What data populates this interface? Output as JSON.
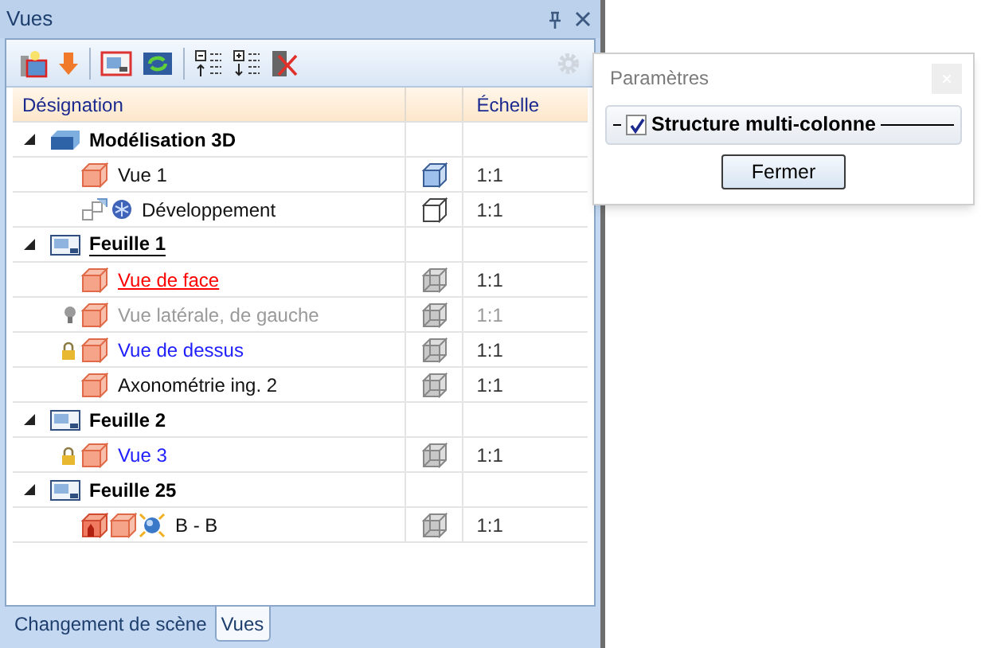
{
  "panel": {
    "title": "Vues"
  },
  "table": {
    "columns": [
      "Désignation",
      "Échelle"
    ],
    "rows": [
      {
        "kind": "model",
        "label": "Modélisation 3D",
        "expanded": true,
        "current": false,
        "children": [
          {
            "kind": "view",
            "label": "Vue 1",
            "scale": "1:1",
            "preview": {
              "kind": "solid"
            },
            "active": false,
            "hidden": false,
            "locked": false
          },
          {
            "kind": "development",
            "label": "Développement",
            "scale": "1:1",
            "preview": {
              "kind": "outline"
            },
            "active": false,
            "hidden": false,
            "locked": false
          }
        ]
      },
      {
        "kind": "sheet",
        "label": "Feuille 1",
        "expanded": true,
        "current": true,
        "children": [
          {
            "kind": "view",
            "label": "Vue de face",
            "scale": "1:1",
            "preview": {
              "kind": "wire"
            },
            "active": true,
            "hidden": false,
            "locked": false
          },
          {
            "kind": "view",
            "label": "Vue latérale, de gauche",
            "scale": "1:1",
            "preview": {
              "kind": "wire"
            },
            "active": false,
            "hidden": true,
            "locked": false
          },
          {
            "kind": "view",
            "label": "Vue de dessus",
            "scale": "1:1",
            "preview": {
              "kind": "wire"
            },
            "active": false,
            "hidden": false,
            "locked": true
          },
          {
            "kind": "view",
            "label": "Axonométrie ing. 2",
            "scale": "1:1",
            "preview": {
              "kind": "wire"
            },
            "active": false,
            "hidden": false,
            "locked": false
          }
        ]
      },
      {
        "kind": "sheet",
        "label": "Feuille 2",
        "expanded": true,
        "current": false,
        "children": [
          {
            "kind": "view",
            "label": "Vue 3",
            "scale": "1:1",
            "preview": {
              "kind": "wire"
            },
            "active": false,
            "hidden": false,
            "locked": true
          }
        ]
      },
      {
        "kind": "sheet",
        "label": "Feuille 25",
        "expanded": true,
        "current": false,
        "children": [
          {
            "kind": "section",
            "label": "B - B",
            "scale": "1:1",
            "preview": {
              "kind": "wire"
            },
            "active": false,
            "hidden": false,
            "locked": false
          }
        ]
      }
    ]
  },
  "tabs": [
    {
      "label": "Changement de scène",
      "selected": false
    },
    {
      "label": "Vues",
      "selected": true
    }
  ],
  "dialog": {
    "title": "Paramètres",
    "option": {
      "label": "Structure multi-colonne",
      "checked": true
    },
    "button": "Fermer"
  }
}
